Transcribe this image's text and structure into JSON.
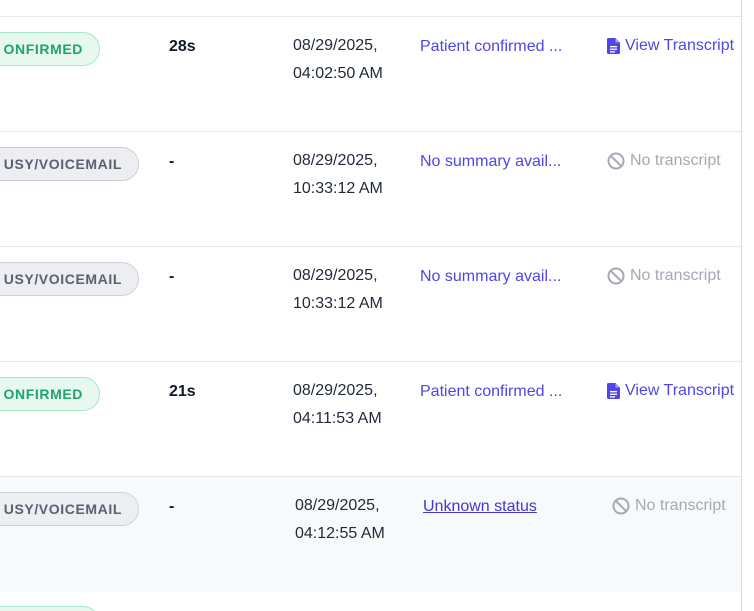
{
  "rows": [
    {
      "status": "CONFIRMED",
      "status_visible": "ONFIRMED",
      "status_color": "#21a36c",
      "duration": "28s",
      "date": "08/29/2025,",
      "time": "04:02:50 AM",
      "summary": "Patient confirmed ...",
      "transcript": "View Transcript",
      "transcript_icon": "document-icon"
    },
    {
      "status": "BUSY/VOICEMAIL",
      "status_visible": "USY/VOICEMAIL",
      "duration": "-",
      "date": "08/29/2025,",
      "time": "10:33:12 AM",
      "summary": "No summary avail...",
      "transcript": "No transcript",
      "transcript_icon": "ban-icon"
    },
    {
      "status": "BUSY/VOICEMAIL",
      "status_visible": "USY/VOICEMAIL",
      "duration": "-",
      "date": "08/29/2025,",
      "time": "10:33:12 AM",
      "summary": "No summary avail...",
      "transcript": "No transcript",
      "transcript_icon": "ban-icon"
    },
    {
      "status": "CONFIRMED",
      "status_visible": "ONFIRMED",
      "duration": "21s",
      "date": "08/29/2025,",
      "time": "04:11:53 AM",
      "summary": "Patient confirmed ...",
      "transcript": "View Transcript",
      "transcript_icon": "document-icon"
    },
    {
      "status": "BUSY/VOICEMAIL",
      "status_visible": "USY/VOICEMAIL",
      "duration": "-",
      "date": "08/29/2025,",
      "time": "04:12:55 AM",
      "summary": "Unknown status",
      "transcript": "No transcript",
      "transcript_icon": "ban-icon"
    }
  ],
  "colors": {
    "confirmed_green": "#21a36c",
    "busy_gray": "#5a6170",
    "link_indigo": "#4f46e5",
    "muted_gray": "#a4a9b3"
  }
}
